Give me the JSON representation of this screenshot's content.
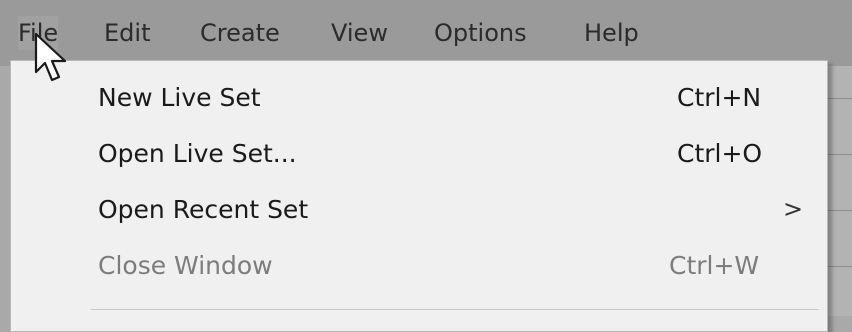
{
  "menubar": {
    "items": [
      {
        "label": "File"
      },
      {
        "label": "Edit"
      },
      {
        "label": "Create"
      },
      {
        "label": "View"
      },
      {
        "label": "Options"
      },
      {
        "label": "Help"
      }
    ]
  },
  "file_menu": {
    "items": [
      {
        "label": "New Live Set",
        "shortcut": "Ctrl+N",
        "enabled": true
      },
      {
        "label": "Open Live Set...",
        "shortcut": "Ctrl+O",
        "enabled": true
      },
      {
        "label": "Open Recent Set",
        "submenu_arrow": ">",
        "enabled": true
      },
      {
        "label": "Close Window",
        "shortcut": "Ctrl+W",
        "enabled": false
      }
    ]
  },
  "colors": {
    "menubar_bg": "#9a9a9a",
    "dropdown_bg": "#f0f0f0",
    "text_enabled": "#1a1a1a",
    "text_disabled": "#7c7c7c"
  },
  "cursor": {
    "icon": "mouse-pointer-icon"
  }
}
